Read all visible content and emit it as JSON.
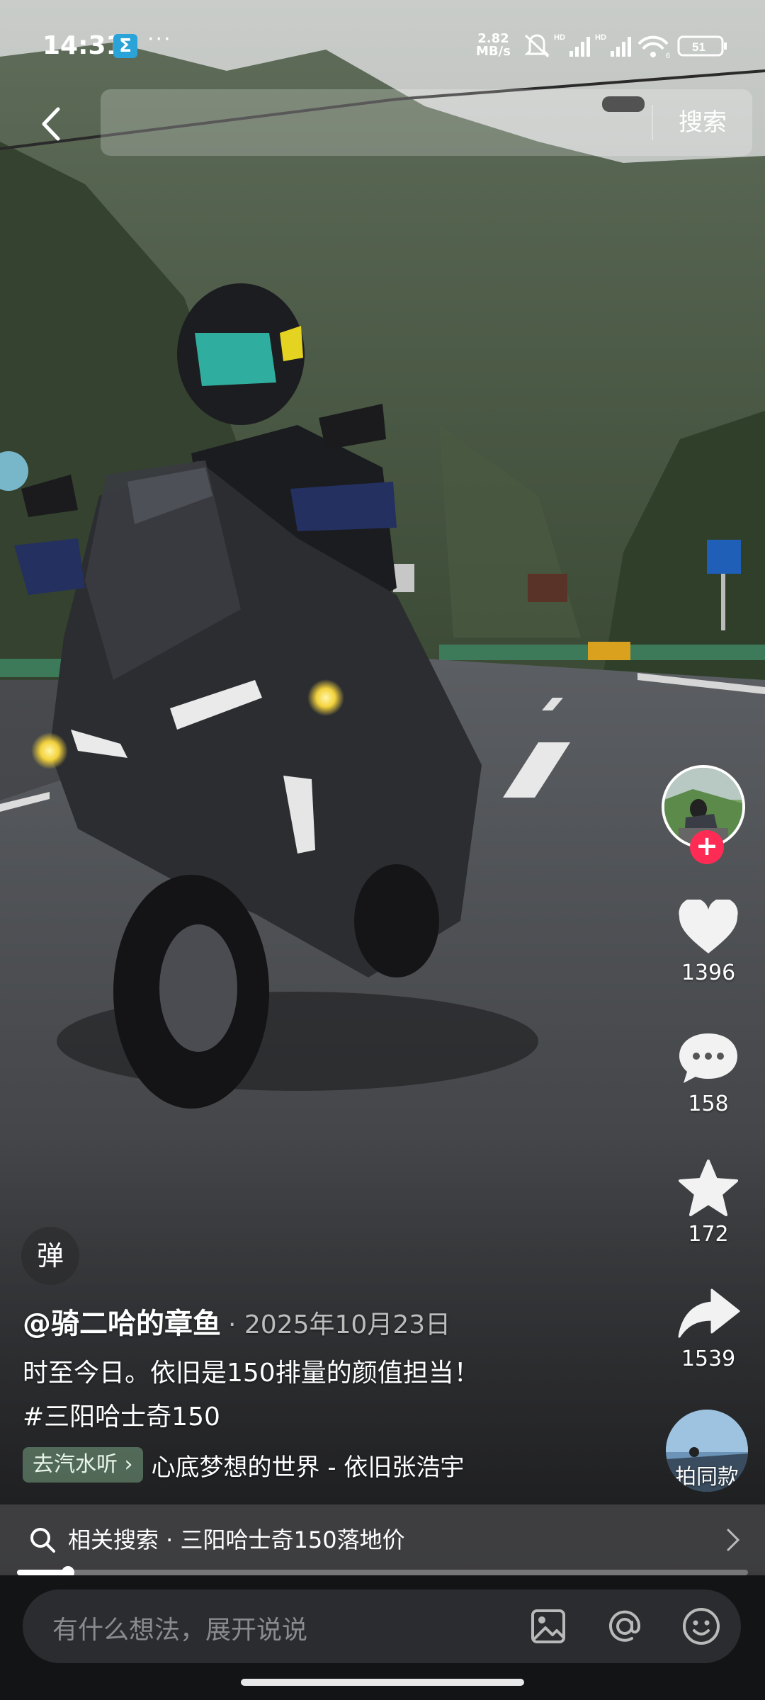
{
  "status_bar": {
    "time": "14:31",
    "app_badge": "Σ",
    "more_dots": "···",
    "net_speed_value": "2.82",
    "net_speed_unit": "MB/s",
    "signal_1_label": "HD",
    "signal_2_label": "HD",
    "wifi_label": "6",
    "battery": "51"
  },
  "top_bar": {
    "search_button": "搜索"
  },
  "right_rail": {
    "likes": "1396",
    "comments": "158",
    "favorites": "172",
    "shares": "1539",
    "same_style": "拍同款"
  },
  "post": {
    "danmaku_label": "弹",
    "author": "@骑二哈的章鱼",
    "date": "· 2025年10月23日",
    "caption_line1": "时至今日。依旧是150排量的颜值担当！",
    "caption_line2": "#三阳哈士奇150",
    "music_tag": "去汽水听 ›",
    "music_title": "心底梦想的世界 - 依旧张浩宇"
  },
  "related_search": {
    "text": "相关搜索 · 三阳哈士奇150落地价"
  },
  "playback": {
    "progress": 0.07
  },
  "comment_bar": {
    "placeholder": "有什么想法，展开说说"
  },
  "colors": {
    "accent_red": "#fe2c55",
    "music_tag_bg": "#8cbe96",
    "bar_bg": "#131416"
  }
}
